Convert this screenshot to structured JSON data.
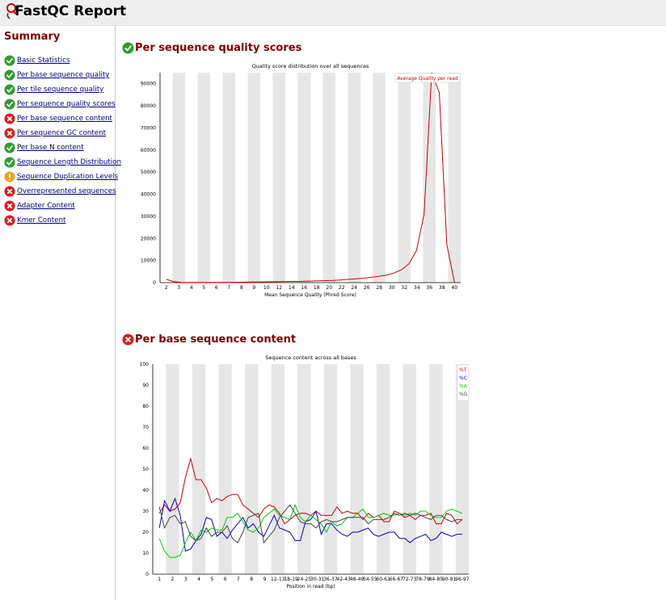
{
  "app": {
    "title": "FastQC Report"
  },
  "summary": {
    "title": "Summary",
    "items": [
      {
        "label": "Basic Statistics",
        "status": "pass",
        "icon": "pass-tick-icon"
      },
      {
        "label": "Per base sequence quality",
        "status": "pass",
        "icon": "pass-tick-icon"
      },
      {
        "label": "Per tile sequence quality",
        "status": "pass",
        "icon": "pass-tick-icon"
      },
      {
        "label": "Per sequence quality scores",
        "status": "pass",
        "icon": "pass-tick-icon"
      },
      {
        "label": "Per base sequence content",
        "status": "fail",
        "icon": "fail-cross-icon"
      },
      {
        "label": "Per sequence GC content",
        "status": "fail",
        "icon": "fail-cross-icon"
      },
      {
        "label": "Per base N content",
        "status": "pass",
        "icon": "pass-tick-icon"
      },
      {
        "label": "Sequence Length Distribution",
        "status": "pass",
        "icon": "pass-tick-icon"
      },
      {
        "label": "Sequence Duplication Levels",
        "status": "warn",
        "icon": "warning-icon"
      },
      {
        "label": "Overrepresented sequences",
        "status": "fail",
        "icon": "fail-cross-icon"
      },
      {
        "label": "Adapter Content",
        "status": "fail",
        "icon": "fail-cross-icon"
      },
      {
        "label": "Kmer Content",
        "status": "fail",
        "icon": "fail-cross-icon"
      }
    ]
  },
  "colors": {
    "pass": "#2e9e2e",
    "fail": "#d92020",
    "warn": "#f0a020",
    "title": "#800000",
    "link": "#000080",
    "band": "#e6e6e6",
    "series_T": "#cc0000",
    "series_C": "#0000cc",
    "series_A": "#00cc00",
    "series_G": "#444444"
  },
  "sections": [
    {
      "title": "Per sequence quality scores",
      "status": "pass",
      "icon": "pass-tick-icon"
    },
    {
      "title": "Per base sequence content",
      "status": "fail",
      "icon": "fail-cross-icon"
    }
  ],
  "chart_data": [
    {
      "type": "line",
      "title": "Quality score distribution over all sequences",
      "xlabel": "Mean Sequence Quality (Phred Score)",
      "ylabel": "",
      "xlim": [
        2,
        40
      ],
      "ylim": [
        0,
        95000
      ],
      "x_ticks": [
        "2",
        "3",
        "4",
        "5",
        "6",
        "7",
        "8",
        "9",
        "10",
        "12",
        "14",
        "16",
        "18",
        "20",
        "22",
        "24",
        "26",
        "28",
        "30",
        "32",
        "34",
        "36",
        "38",
        "40"
      ],
      "y_ticks": [
        "0",
        "10000",
        "20000",
        "30000",
        "40000",
        "50000",
        "60000",
        "70000",
        "80000",
        "90000"
      ],
      "grid": "alternating vertical bands",
      "legend": "top-right",
      "series": [
        {
          "name": "Average Quality per read",
          "color": "#cc0000",
          "x": [
            2,
            3,
            4,
            5,
            6,
            7,
            8,
            9,
            10,
            11,
            12,
            13,
            14,
            15,
            16,
            17,
            18,
            19,
            20,
            21,
            22,
            23,
            24,
            25,
            26,
            27,
            28,
            29,
            30,
            31,
            32,
            33,
            34,
            35,
            36,
            37,
            38,
            39,
            40
          ],
          "y": [
            1500,
            400,
            150,
            100,
            100,
            100,
            100,
            100,
            120,
            150,
            200,
            250,
            300,
            350,
            400,
            450,
            500,
            550,
            600,
            700,
            800,
            900,
            1000,
            1200,
            1500,
            1700,
            2000,
            2400,
            2800,
            3400,
            4300,
            5800,
            8500,
            14500,
            31000,
            95000,
            86000,
            17000,
            200
          ]
        }
      ]
    },
    {
      "type": "line",
      "title": "Sequence content across all bases",
      "xlabel": "Position in read (bp)",
      "ylabel": "",
      "ylim": [
        0,
        100
      ],
      "x_ticks": [
        "1",
        "2",
        "3",
        "4",
        "5",
        "6",
        "7",
        "8",
        "9",
        "12-13",
        "18-19",
        "24-25",
        "30-31",
        "36-37",
        "42-43",
        "48-49",
        "54-55",
        "60-61",
        "66-67",
        "72-73",
        "78-79",
        "84-85",
        "90-91",
        "96-97"
      ],
      "y_ticks": [
        "0",
        "10",
        "20",
        "30",
        "40",
        "50",
        "60",
        "70",
        "80",
        "90",
        "100"
      ],
      "grid": "alternating vertical bands",
      "legend": "top-right",
      "series": [
        {
          "name": "%T",
          "color": "#cc0000",
          "values": [
            29,
            33,
            30,
            31,
            34,
            46,
            55,
            45,
            45,
            41,
            34,
            36,
            35,
            37,
            38,
            38,
            33,
            31,
            29,
            27,
            31,
            33,
            32,
            29,
            24,
            26,
            28,
            29,
            29,
            28,
            30,
            28,
            28,
            28,
            32,
            29,
            30,
            29,
            29,
            26,
            29,
            27,
            28,
            25,
            25,
            30,
            29,
            27,
            28,
            26,
            28,
            28,
            29,
            24,
            24,
            29,
            28,
            24,
            26
          ]
        },
        {
          "name": "%C",
          "color": "#0000cc",
          "values": [
            22,
            35,
            30,
            36,
            28,
            11,
            12,
            16,
            19,
            27,
            26,
            18,
            20,
            17,
            21,
            24,
            27,
            22,
            24,
            20,
            18,
            23,
            28,
            22,
            21,
            20,
            16,
            16,
            25,
            26,
            30,
            19,
            24,
            24,
            21,
            19,
            18,
            20,
            20,
            21,
            22,
            19,
            18,
            19,
            20,
            20,
            17,
            17,
            15,
            17,
            18,
            19,
            16,
            17,
            20,
            19,
            18,
            19,
            19
          ]
        },
        {
          "name": "%A",
          "color": "#00cc00",
          "values": [
            17,
            11,
            8,
            8,
            9,
            15,
            20,
            16,
            21,
            20,
            22,
            21,
            21,
            27,
            27,
            29,
            25,
            21,
            20,
            22,
            27,
            29,
            31,
            28,
            27,
            26,
            33,
            27,
            25,
            28,
            26,
            24,
            20,
            25,
            23,
            24,
            27,
            27,
            29,
            31,
            27,
            27,
            28,
            29,
            28,
            28,
            29,
            28,
            29,
            28,
            30,
            30,
            28,
            27,
            27,
            30,
            31,
            30,
            29
          ]
        },
        {
          "name": "%G",
          "color": "#444444",
          "values": [
            32,
            22,
            27,
            28,
            24,
            25,
            18,
            16,
            17,
            22,
            18,
            20,
            20,
            23,
            17,
            15,
            20,
            27,
            28,
            29,
            15,
            18,
            21,
            27,
            30,
            33,
            29,
            25,
            24,
            24,
            22,
            25,
            26,
            25,
            25,
            26,
            27,
            27,
            27,
            27,
            24,
            26,
            26,
            26,
            27,
            29,
            28,
            29,
            28,
            29,
            28,
            27,
            26,
            28,
            28,
            26,
            25,
            26,
            26
          ]
        }
      ]
    }
  ]
}
